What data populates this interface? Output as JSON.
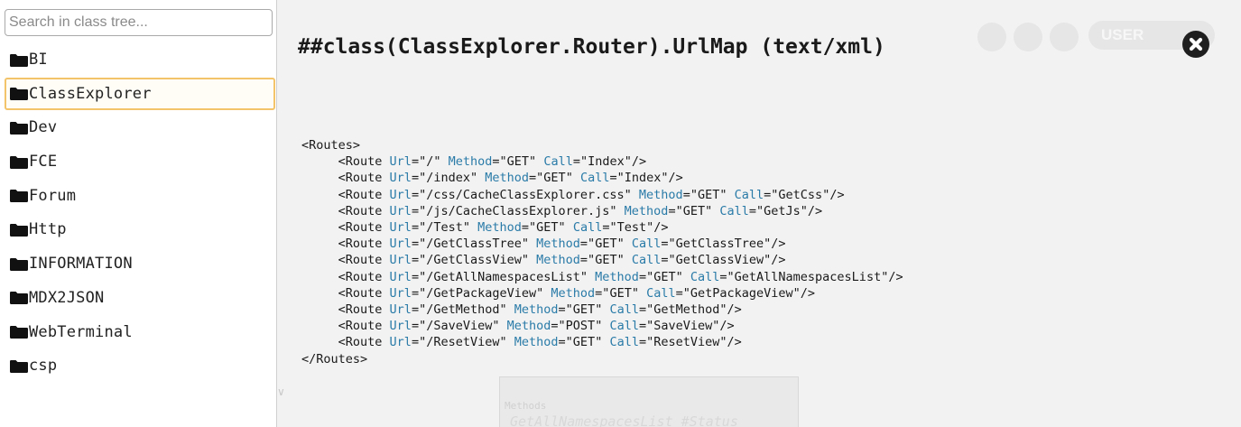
{
  "sidebar": {
    "search_placeholder": "Search in class tree...",
    "items": [
      {
        "label": "BI",
        "selected": false
      },
      {
        "label": "ClassExplorer",
        "selected": true
      },
      {
        "label": "Dev",
        "selected": false
      },
      {
        "label": "FCE",
        "selected": false
      },
      {
        "label": "Forum",
        "selected": false
      },
      {
        "label": "Http",
        "selected": false
      },
      {
        "label": "INFORMATION",
        "selected": false
      },
      {
        "label": "MDX2JSON",
        "selected": false
      },
      {
        "label": "WebTerminal",
        "selected": false
      },
      {
        "label": "csp",
        "selected": false
      }
    ],
    "item_icon": "folder-icon",
    "selected_border_color": "#f3c46a"
  },
  "background": {
    "user_label": "USER",
    "behind_text_1": "Methods",
    "behind_text_2": "GetAllNamespacesList #Status",
    "icons": [
      "info-icon",
      "help-icon",
      "gear-icon"
    ]
  },
  "viewer": {
    "title": "##class(ClassExplorer.Router).UrlMap (text/xml)",
    "close_icon": "close-icon",
    "root_open": "<Routes>",
    "root_close": "</Routes>",
    "routes": [
      {
        "url": "/",
        "method": "GET",
        "call": "Index"
      },
      {
        "url": "/index",
        "method": "GET",
        "call": "Index"
      },
      {
        "url": "/css/CacheClassExplorer.css",
        "method": "GET",
        "call": "GetCss"
      },
      {
        "url": "/js/CacheClassExplorer.js",
        "method": "GET",
        "call": "GetJs"
      },
      {
        "url": "/Test",
        "method": "GET",
        "call": "Test"
      },
      {
        "url": "/GetClassTree",
        "method": "GET",
        "call": "GetClassTree"
      },
      {
        "url": "/GetClassView",
        "method": "GET",
        "call": "GetClassView"
      },
      {
        "url": "/GetAllNamespacesList",
        "method": "GET",
        "call": "GetAllNamespacesList"
      },
      {
        "url": "/GetPackageView",
        "method": "GET",
        "call": "GetPackageView"
      },
      {
        "url": "/GetMethod",
        "method": "GET",
        "call": "GetMethod"
      },
      {
        "url": "/SaveView",
        "method": "POST",
        "call": "SaveView"
      },
      {
        "url": "/ResetView",
        "method": "GET",
        "call": "ResetView"
      }
    ]
  },
  "colors": {
    "attribute": "#2a7ba8",
    "text": "#1a1a1a",
    "main_background": "#f2f2f2"
  }
}
